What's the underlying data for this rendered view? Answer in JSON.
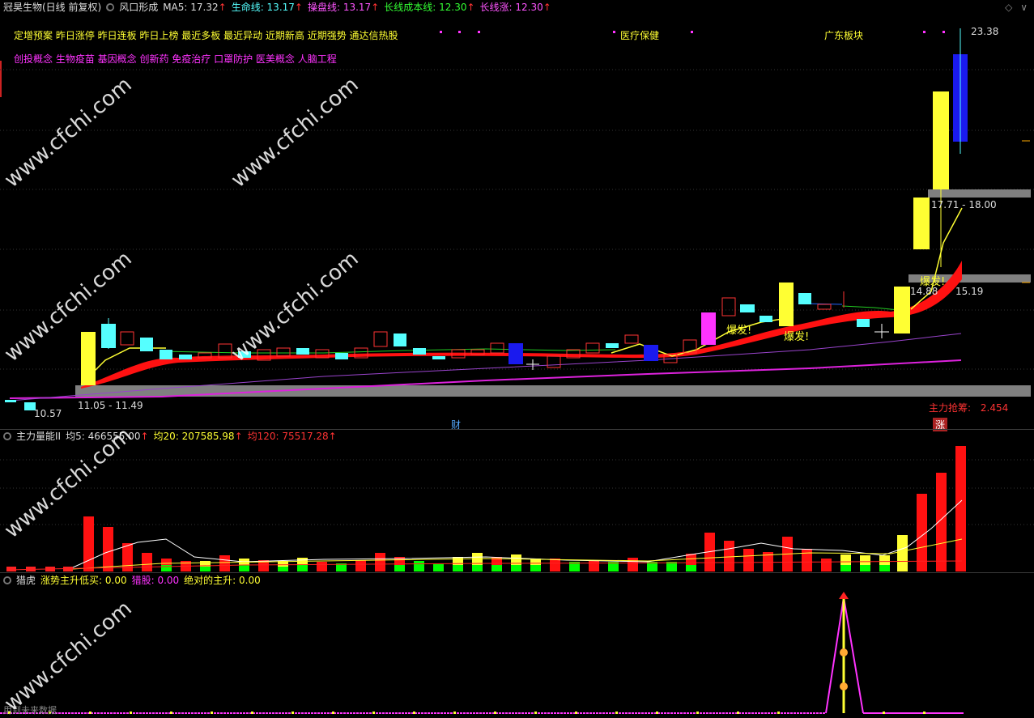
{
  "header": {
    "stock_title": "冠昊生物(日线 前复权)",
    "indicator_name": "风口形成",
    "ma5": "MA5: 17.32",
    "lifeline": "生命线: 13.17",
    "operate_line": "操盘线: 13.17",
    "long_cost": "长线成本线: 12.30",
    "long_rise": "长线涨: 12.30",
    "up_arrow": "↑"
  },
  "concepts": {
    "line1": "定增预案 昨日涨停 昨日连板 昨日上榜 最近多板 最近异动 近期新高 近期强势 通达信热股",
    "line2": "创投概念 生物疫苗 基因概念 创新药 免疫治疗 口罩防护 医美概念 人脑工程",
    "sector1": "医疗保健",
    "sector2": "广东板块"
  },
  "main_chart": {
    "high_label": "23.38",
    "range_upper": "17.71 - 18.00",
    "range_mid_a": "14.88",
    "range_mid_b": "15.19",
    "range_lower": "11.05 - 11.49",
    "low_label": "10.57",
    "burst": "爆发!",
    "main_raise_label": "主力抢筹:",
    "main_raise_value": "2.454",
    "cai": "财",
    "zhang": "涨"
  },
  "volume_panel": {
    "name": "主力量能II",
    "avg5": "均5: 466555.00",
    "avg20": "均20: 207585.98",
    "avg120": "均120: 75517.28"
  },
  "hunter_panel": {
    "name": "猎虎",
    "trend": "涨势主升低买: 0.00",
    "hunt": "猎股: 0.00",
    "absolute": "绝对的主升: 0.00",
    "future": "用到未来数据"
  },
  "watermark": "www.cfchi.com",
  "colors": {
    "yellow": "#ffff33",
    "cyan": "#55ffff",
    "blue": "#0000ff",
    "red": "#ff0000",
    "magenta": "#ff33ff",
    "green": "#00ff00",
    "gray": "#808080"
  }
}
